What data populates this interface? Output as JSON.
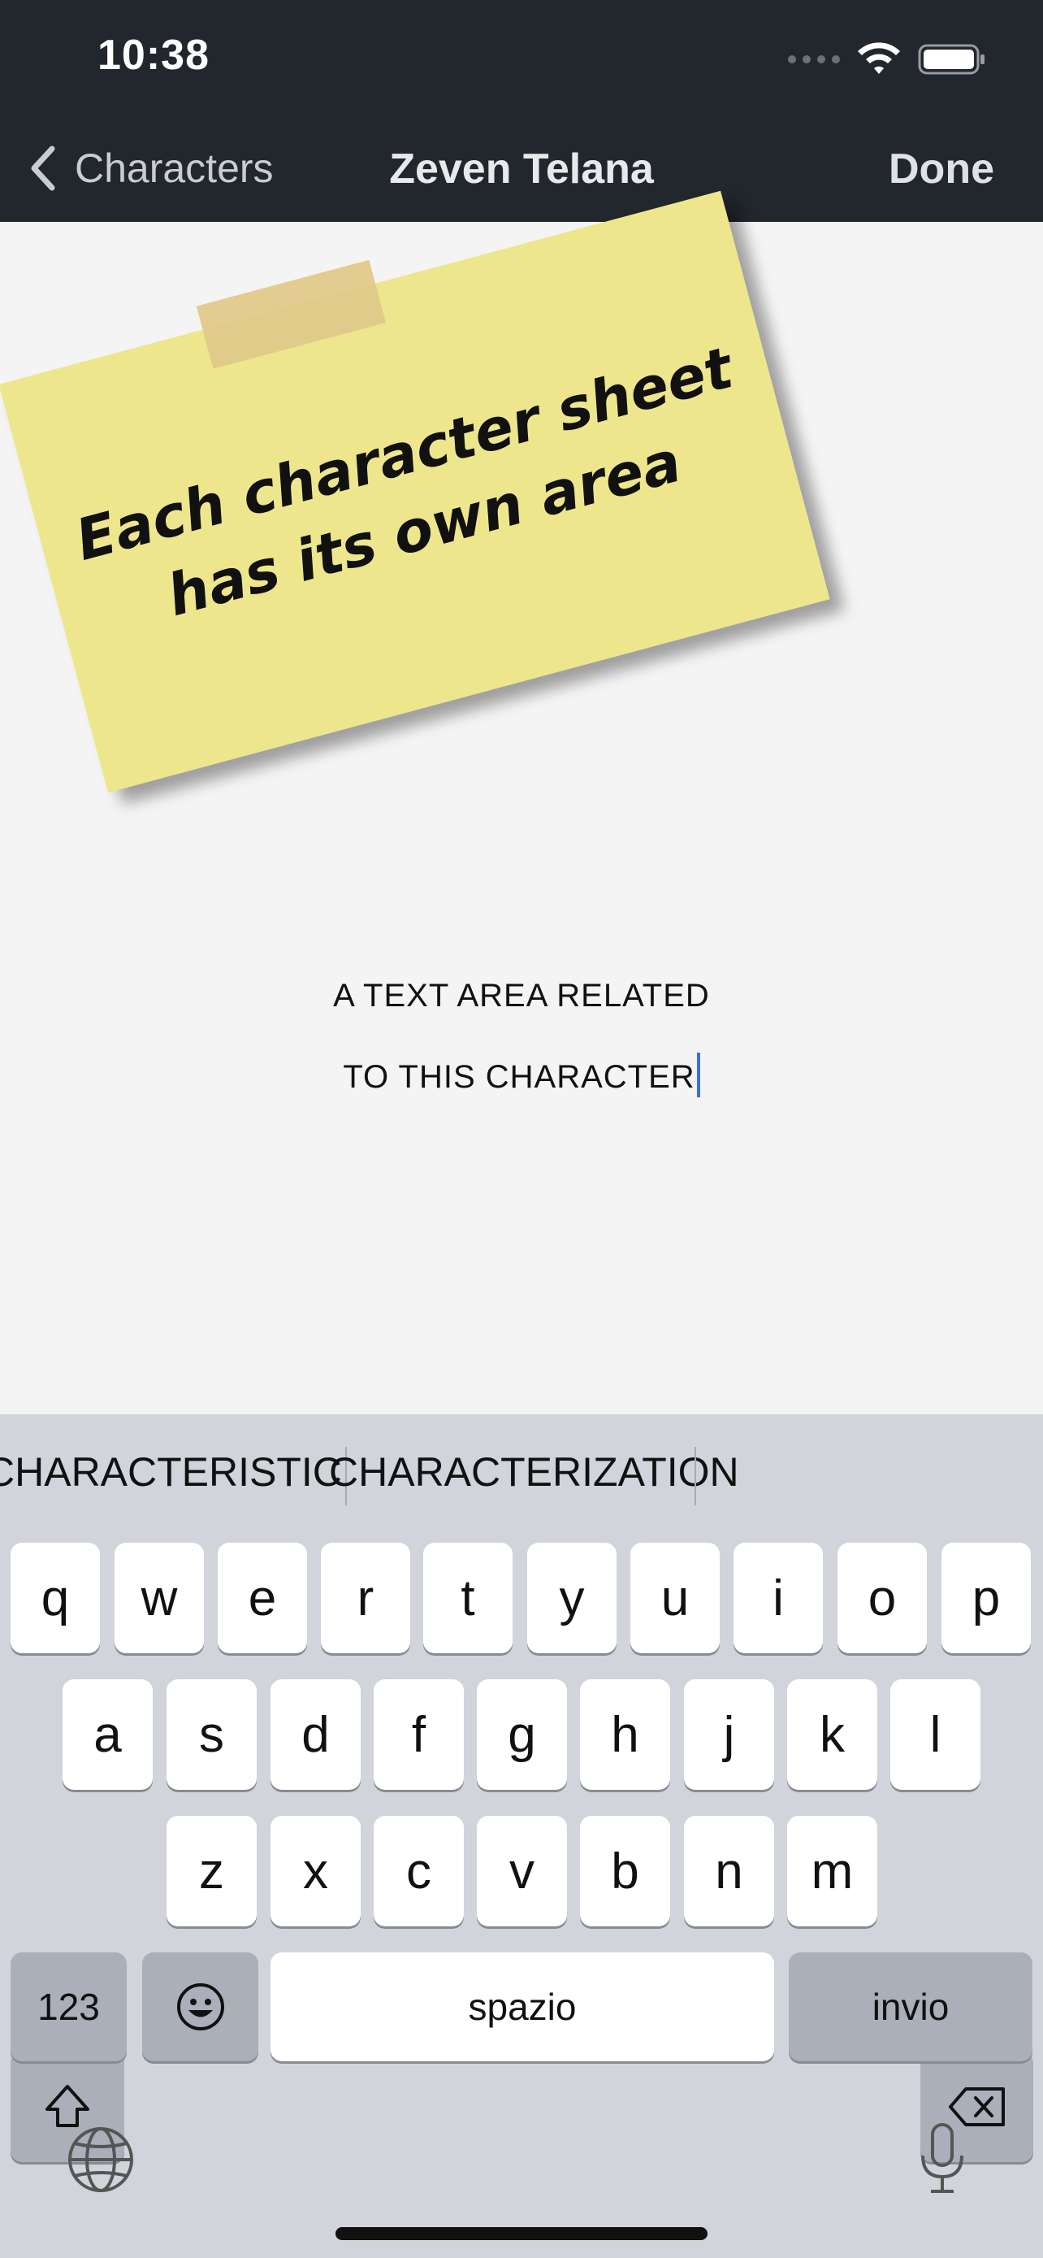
{
  "status_bar": {
    "time": "10:38"
  },
  "nav": {
    "back_label": "Characters",
    "title": "Zeven Telana",
    "done_label": "Done"
  },
  "note": {
    "line1": "Each character sheet",
    "line2": "has its own area"
  },
  "text_area": {
    "line1": "A TEXT AREA RELATED",
    "line2": "TO THIS CHARACTER"
  },
  "keyboard": {
    "suggestions": [
      "CHARACTERISTIC",
      "CHARACTERIZATION"
    ],
    "row1": [
      "q",
      "w",
      "e",
      "r",
      "t",
      "y",
      "u",
      "i",
      "o",
      "p"
    ],
    "row2": [
      "a",
      "s",
      "d",
      "f",
      "g",
      "h",
      "j",
      "k",
      "l"
    ],
    "row3": [
      "z",
      "x",
      "c",
      "v",
      "b",
      "n",
      "m"
    ],
    "numbers_label": "123",
    "space_label": "spazio",
    "return_label": "invio"
  },
  "colors": {
    "nav_background": "#22262d",
    "note": "#ede68d",
    "caret": "#3a6de0",
    "keyboard": "#d2d4db"
  }
}
